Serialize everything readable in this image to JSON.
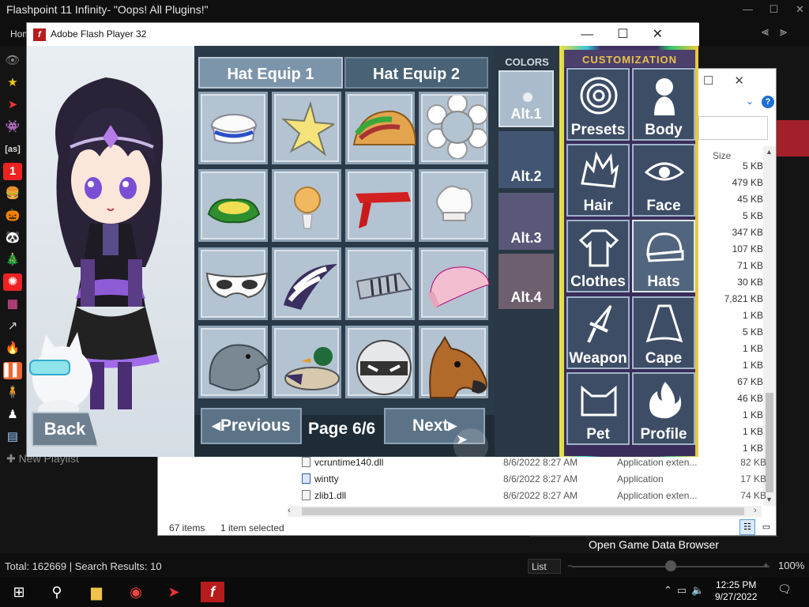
{
  "launcher": {
    "title": "Flashpoint 11 Infinity- \"Oops! All Plugins!\"",
    "home_tab": "Hom",
    "new_playlist": "New Playlist",
    "total_text": "Total: 162669",
    "search_results": "Search Results: 10",
    "separator": "|",
    "list_select": "List",
    "zoom": "100%",
    "open_data_browser": "Open Game Data Browser"
  },
  "explorer": {
    "size_header": "Size",
    "sizes": [
      "5 KB",
      "479 KB",
      "45 KB",
      "5 KB",
      "347 KB",
      "107 KB",
      "71 KB",
      "30 KB",
      "7,821 KB",
      "1 KB",
      "5 KB",
      "1 KB",
      "1 KB",
      "67 KB",
      "46 KB",
      "1 KB",
      "1 KB",
      "1 KB"
    ],
    "rows": [
      {
        "name": "vcruntime140.dll",
        "date": "8/6/2022 8:27 AM",
        "type": "Application exten...",
        "size": "82 KB"
      },
      {
        "name": "wintty",
        "date": "8/6/2022 8:27 AM",
        "type": "Application",
        "size": "17 KB"
      },
      {
        "name": "zlib1.dll",
        "date": "8/6/2022 8:27 AM",
        "type": "Application exten...",
        "size": "74 KB"
      }
    ],
    "items_count": "67 items",
    "selected": "1 item selected",
    "help_icon": "?"
  },
  "flash": {
    "window_title": "Adobe Flash Player 32",
    "logo": "f"
  },
  "game": {
    "back_label": "Back",
    "tabs": [
      "Hat Equip 1",
      "Hat Equip 2"
    ],
    "previous_label": "Previous",
    "next_label": "Next",
    "page_label": "Page 6/6",
    "colors_header": "COLORS",
    "alts": [
      "Alt.1",
      "Alt.2",
      "Alt.3",
      "Alt.4"
    ],
    "customization_header": "CUSTOMIZATION",
    "custom_buttons": [
      "Presets",
      "Body",
      "Hair",
      "Face",
      "Clothes",
      "Hats",
      "Weapon",
      "Cape",
      "Pet",
      "Profile"
    ],
    "hat_items": [
      "sailor-hat-icon",
      "star-hat-icon",
      "taco-hat-icon",
      "flower-hat-icon",
      "leaf-hat-icon",
      "bulb-hat-icon",
      "red-bandana-icon",
      "chef-hat-icon",
      "eye-mask-icon",
      "striped-scarf-icon",
      "knight-visor-icon",
      "pink-beanie-icon",
      "dolphin-hat-icon",
      "duck-hat-icon",
      "robot-helmet-icon",
      "horse-mask-icon"
    ]
  },
  "taskbar": {
    "time": "12:25 PM",
    "date": "9/27/2022"
  },
  "colors": {
    "accent_gold": "#e8c24a",
    "flash_red": "#b71c1c",
    "panel_blue": "#b3c3d1"
  }
}
